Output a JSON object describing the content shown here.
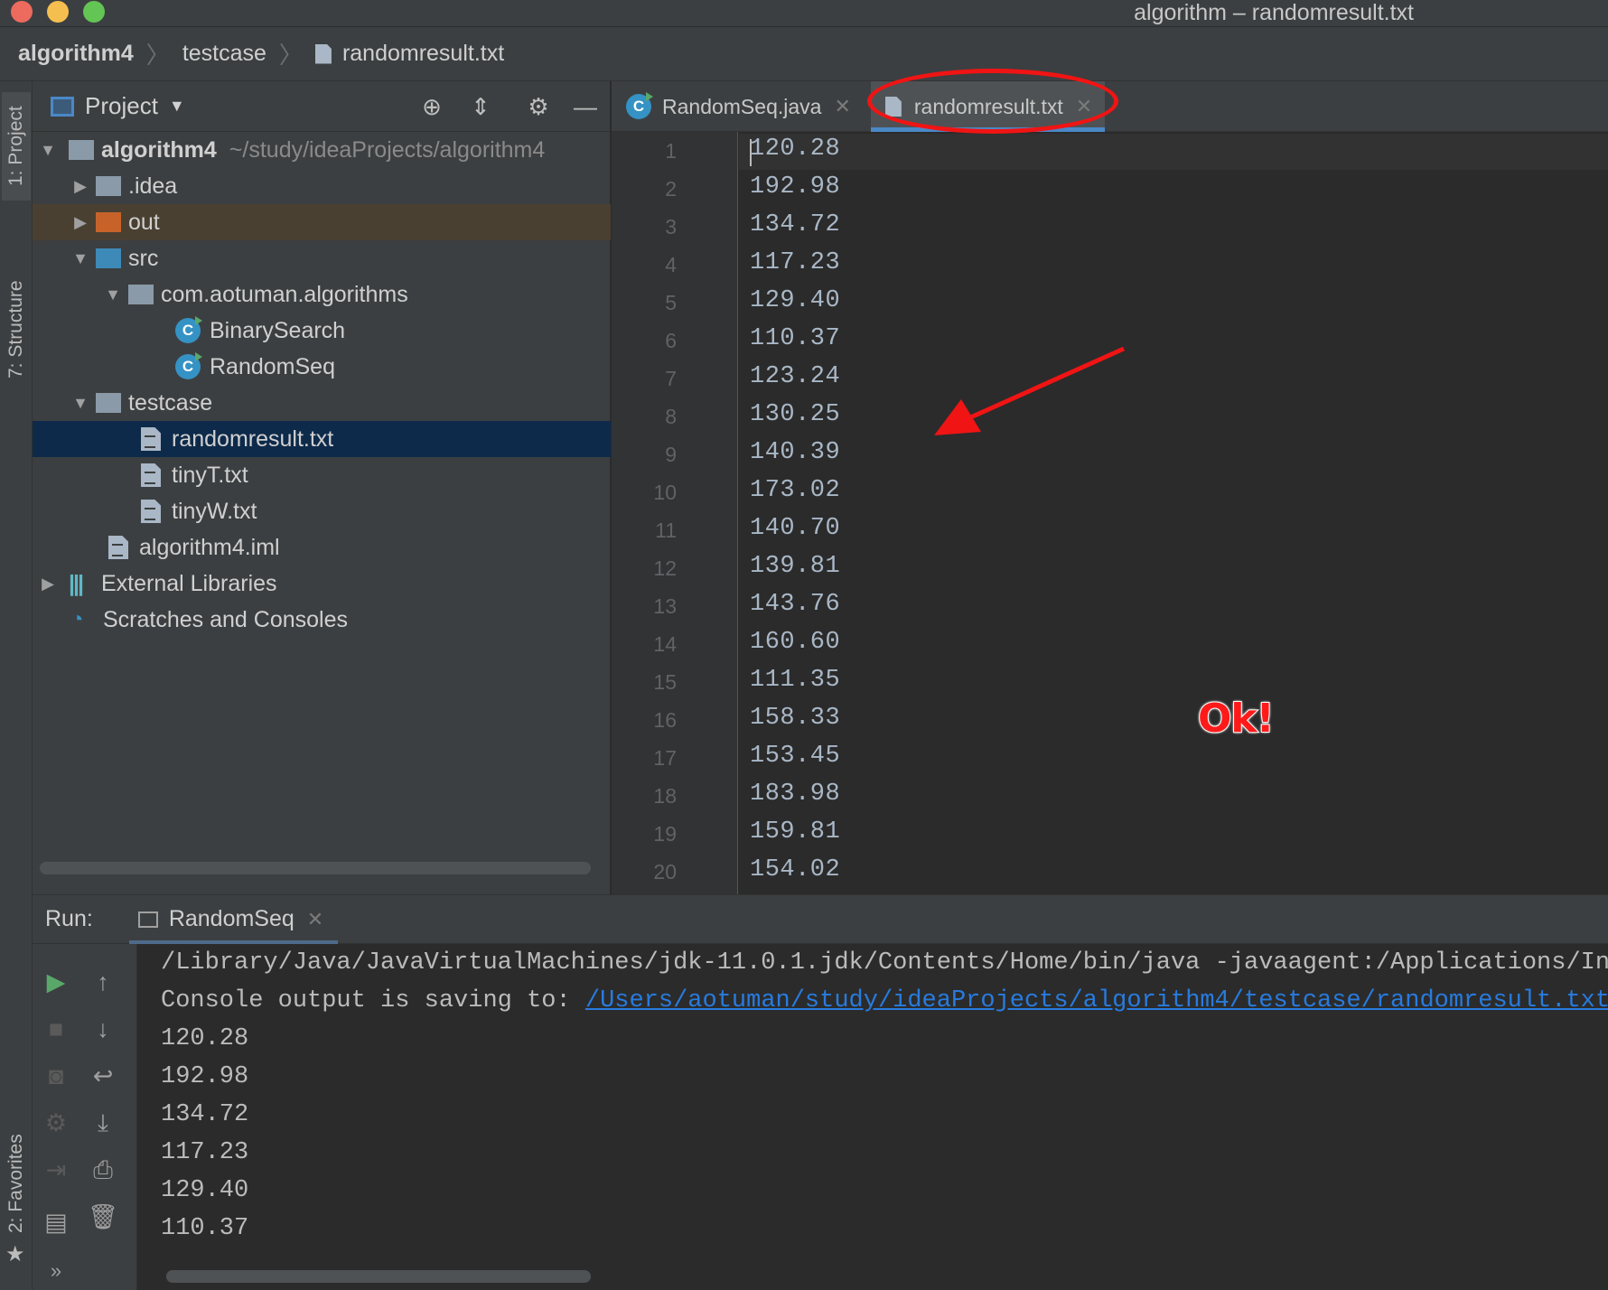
{
  "window": {
    "title": "algorithm – randomresult.txt",
    "traffic_colors": [
      "#ed6a5e",
      "#f5bf4f",
      "#62c554"
    ]
  },
  "breadcrumb": [
    "algorithm4",
    "testcase",
    "randomresult.txt"
  ],
  "left_strip": {
    "project_tab": "1: Project",
    "structure_tab": "7: Structure",
    "favorites_tab": "2: Favorites"
  },
  "project_panel": {
    "title": "Project",
    "tree": [
      {
        "label": "algorithm4",
        "note": "~/study/ideaProjects/algorithm4",
        "icon": "module-folder-icon",
        "expanded": true
      },
      {
        "label": ".idea",
        "icon": "folder-icon",
        "expanded": false
      },
      {
        "label": "out",
        "icon": "excluded-folder-icon",
        "expanded": false
      },
      {
        "label": "src",
        "icon": "source-folder-icon",
        "expanded": true
      },
      {
        "label": "com.aotuman.algorithms",
        "icon": "package-icon",
        "expanded": true
      },
      {
        "label": "BinarySearch",
        "icon": "java-class-icon"
      },
      {
        "label": "RandomSeq",
        "icon": "java-class-icon"
      },
      {
        "label": "testcase",
        "icon": "folder-icon",
        "expanded": true
      },
      {
        "label": "randomresult.txt",
        "icon": "text-file-icon",
        "selected": true
      },
      {
        "label": "tinyT.txt",
        "icon": "text-file-icon"
      },
      {
        "label": "tinyW.txt",
        "icon": "text-file-icon"
      },
      {
        "label": "algorithm4.iml",
        "icon": "iml-file-icon"
      },
      {
        "label": "External Libraries",
        "icon": "libraries-icon",
        "expanded": false
      },
      {
        "label": "Scratches and Consoles",
        "icon": "scratches-icon"
      }
    ]
  },
  "editor": {
    "tabs": [
      {
        "label": "RandomSeq.java",
        "icon": "java-class-icon",
        "active": false
      },
      {
        "label": "randomresult.txt",
        "icon": "text-file-icon",
        "active": true
      }
    ],
    "line_numbers": [
      "1",
      "2",
      "3",
      "4",
      "5",
      "6",
      "7",
      "8",
      "9",
      "10",
      "11",
      "12",
      "13",
      "14",
      "15",
      "16",
      "17",
      "18",
      "19",
      "20"
    ],
    "lines": [
      "120.28",
      "192.98",
      "134.72",
      "117.23",
      "129.40",
      "110.37",
      "123.24",
      "130.25",
      "140.39",
      "173.02",
      "140.70",
      "139.81",
      "143.76",
      "160.60",
      "111.35",
      "158.33",
      "153.45",
      "183.98",
      "159.81",
      "154.02"
    ]
  },
  "run_panel": {
    "label": "Run:",
    "tab": "RandomSeq",
    "command": "/Library/Java/JavaVirtualMachines/jdk-11.0.1.jdk/Contents/Home/bin/java -javaagent:/Applications/Int",
    "saving_prefix": "Console output is saving to: ",
    "saving_link": "/Users/aotuman/study/ideaProjects/algorithm4/testcase/randomresult.txt",
    "output": [
      "120.28",
      "192.98",
      "134.72",
      "117.23",
      "129.40",
      "110.37"
    ],
    "more": "»"
  },
  "annotation": {
    "ok_text": "Ok!",
    "color": "#ff1a1a"
  }
}
